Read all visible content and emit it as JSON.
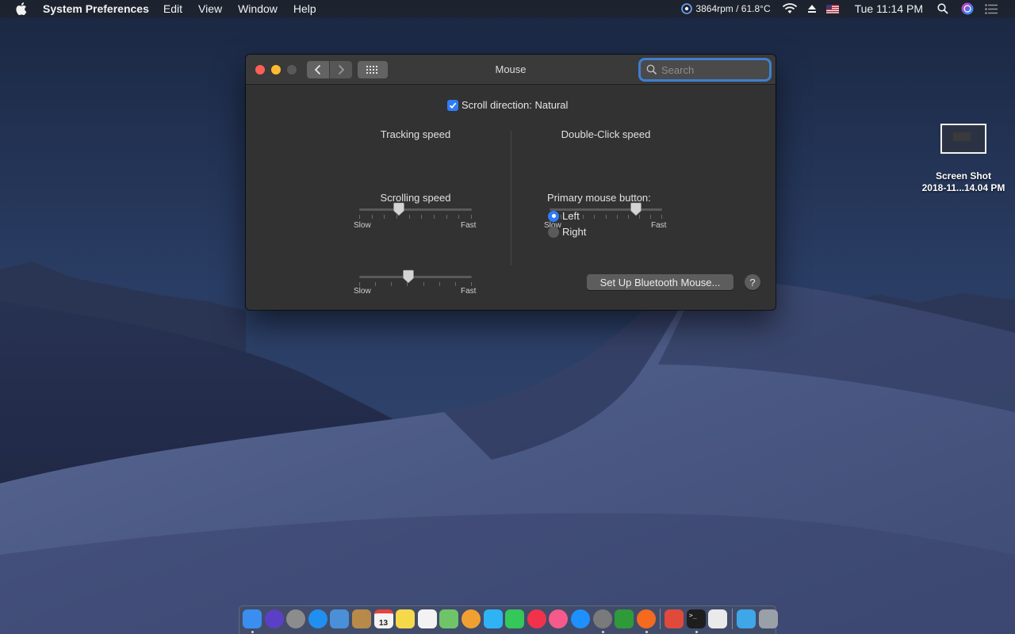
{
  "menubar": {
    "app_name": "System Preferences",
    "menus": [
      "Edit",
      "View",
      "Window",
      "Help"
    ],
    "fan_status": "3864rpm / 61.8°C",
    "clock": "Tue 11:14 PM"
  },
  "desktop": {
    "file_name_line1": "Screen Shot",
    "file_name_line2": "2018-11...14.04 PM"
  },
  "window": {
    "title": "Mouse",
    "search_placeholder": "Search",
    "scroll_direction_label": "Scroll direction: Natural",
    "scroll_direction_checked": true,
    "tracking": {
      "label": "Tracking speed",
      "min_label": "Slow",
      "max_label": "Fast",
      "value": 0.35
    },
    "scrolling": {
      "label": "Scrolling speed",
      "min_label": "Slow",
      "max_label": "Fast",
      "value": 0.44
    },
    "double_click": {
      "label": "Double-Click speed",
      "min_label": "Slow",
      "max_label": "Fast",
      "value": 0.77
    },
    "primary_button": {
      "label": "Primary mouse button:",
      "options": [
        "Left",
        "Right"
      ],
      "selected": "Left"
    },
    "bluetooth_button": "Set Up Bluetooth Mouse...",
    "help_button": "?"
  },
  "colors": {
    "accent": "#2f7cf6",
    "close": "#fe5f57",
    "minimize": "#febc2e"
  },
  "dock": {
    "items": [
      {
        "name": "finder-icon",
        "color": "#3a8ef0",
        "running": true
      },
      {
        "name": "siri-icon",
        "color": "#5b3fc4",
        "running": false
      },
      {
        "name": "launchpad-icon",
        "color": "#8c8c8c",
        "running": false
      },
      {
        "name": "safari-icon",
        "color": "#1f8ff0",
        "running": false
      },
      {
        "name": "mail-icon",
        "color": "#4a90d9",
        "running": false
      },
      {
        "name": "contacts-icon",
        "color": "#b88a4a",
        "running": false
      },
      {
        "name": "calendar-icon",
        "color": "#f4f4f4",
        "running": false
      },
      {
        "name": "notes-icon",
        "color": "#f6d94a",
        "running": false
      },
      {
        "name": "reminders-icon",
        "color": "#f2f2f2",
        "running": false
      },
      {
        "name": "maps-icon",
        "color": "#6fc46a",
        "running": false
      },
      {
        "name": "photos-icon",
        "color": "#f0a030",
        "running": false
      },
      {
        "name": "messages-icon",
        "color": "#2fb3f5",
        "running": false
      },
      {
        "name": "facetime-icon",
        "color": "#34c759",
        "running": false
      },
      {
        "name": "news-icon",
        "color": "#f2324a",
        "running": false
      },
      {
        "name": "music-icon",
        "color": "#f65a8b",
        "running": false
      },
      {
        "name": "app-store-icon",
        "color": "#1e90ff",
        "running": false
      },
      {
        "name": "system-preferences-icon",
        "color": "#7a7a7a",
        "running": true
      },
      {
        "name": "vim-icon",
        "color": "#2f9a3a",
        "running": false
      },
      {
        "name": "firefox-icon",
        "color": "#f56a1f",
        "running": true
      },
      {
        "name": "separator",
        "color": "",
        "running": false
      },
      {
        "name": "xcode-icon",
        "color": "#e04a3a",
        "running": false
      },
      {
        "name": "terminal-icon",
        "color": "#1e1e1e",
        "running": true
      },
      {
        "name": "textedit-icon",
        "color": "#eaeaea",
        "running": false
      },
      {
        "name": "separator",
        "color": "",
        "running": false
      },
      {
        "name": "downloads-folder-icon",
        "color": "#3fa6e8",
        "running": false
      },
      {
        "name": "trash-icon",
        "color": "#9aa0a8",
        "running": false
      }
    ],
    "calendar_day": "13"
  }
}
